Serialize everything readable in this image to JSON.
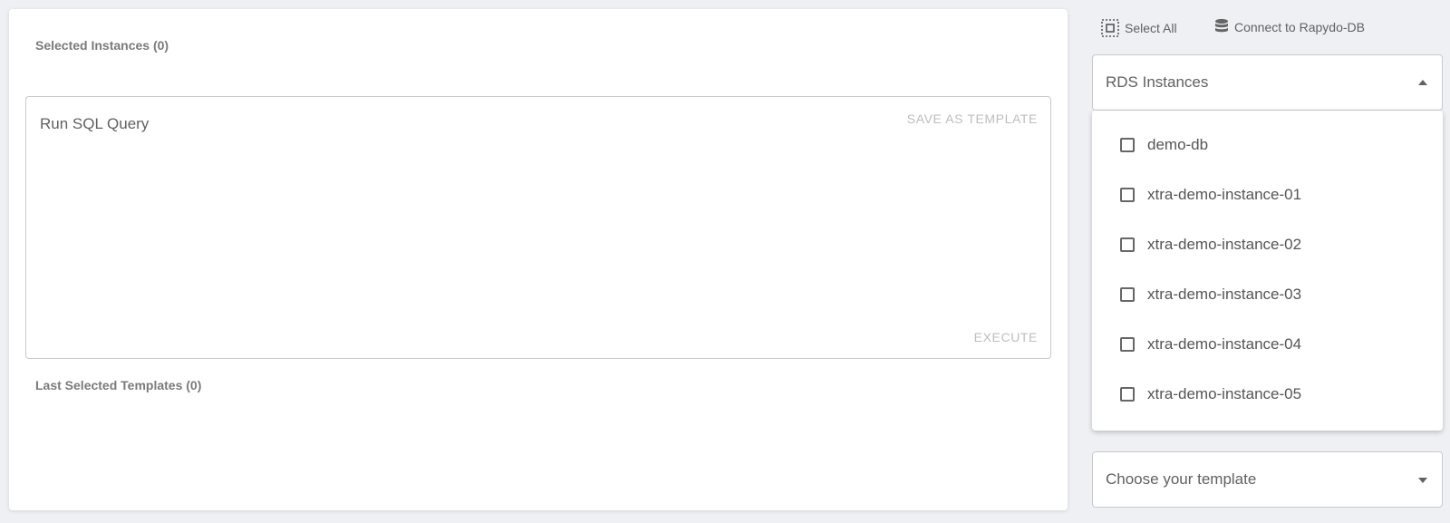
{
  "main": {
    "selected_instances_label": "Selected Instances (0)",
    "query": {
      "placeholder": "Run SQL Query",
      "save_template_label": "SAVE AS TEMPLATE",
      "execute_label": "EXECUTE"
    },
    "last_templates_label": "Last Selected Templates (0)"
  },
  "toolbar": {
    "select_all_label": "Select All",
    "select_all_icon": "select-all-icon",
    "connect_label": "Connect to Rapydo-DB",
    "connect_icon": "database-icon"
  },
  "rds_select": {
    "label": "RDS Instances",
    "expanded": true,
    "options": [
      {
        "label": "demo-db",
        "checked": false
      },
      {
        "label": "xtra-demo-instance-01",
        "checked": false
      },
      {
        "label": "xtra-demo-instance-02",
        "checked": false
      },
      {
        "label": "xtra-demo-instance-03",
        "checked": false
      },
      {
        "label": "xtra-demo-instance-04",
        "checked": false
      },
      {
        "label": "xtra-demo-instance-05",
        "checked": false
      }
    ]
  },
  "template_select": {
    "label": "Choose your template"
  },
  "colors": {
    "background": "#eef0f4",
    "card": "#ffffff",
    "muted_text": "#bdbdbd",
    "border": "#c9c9c9"
  }
}
